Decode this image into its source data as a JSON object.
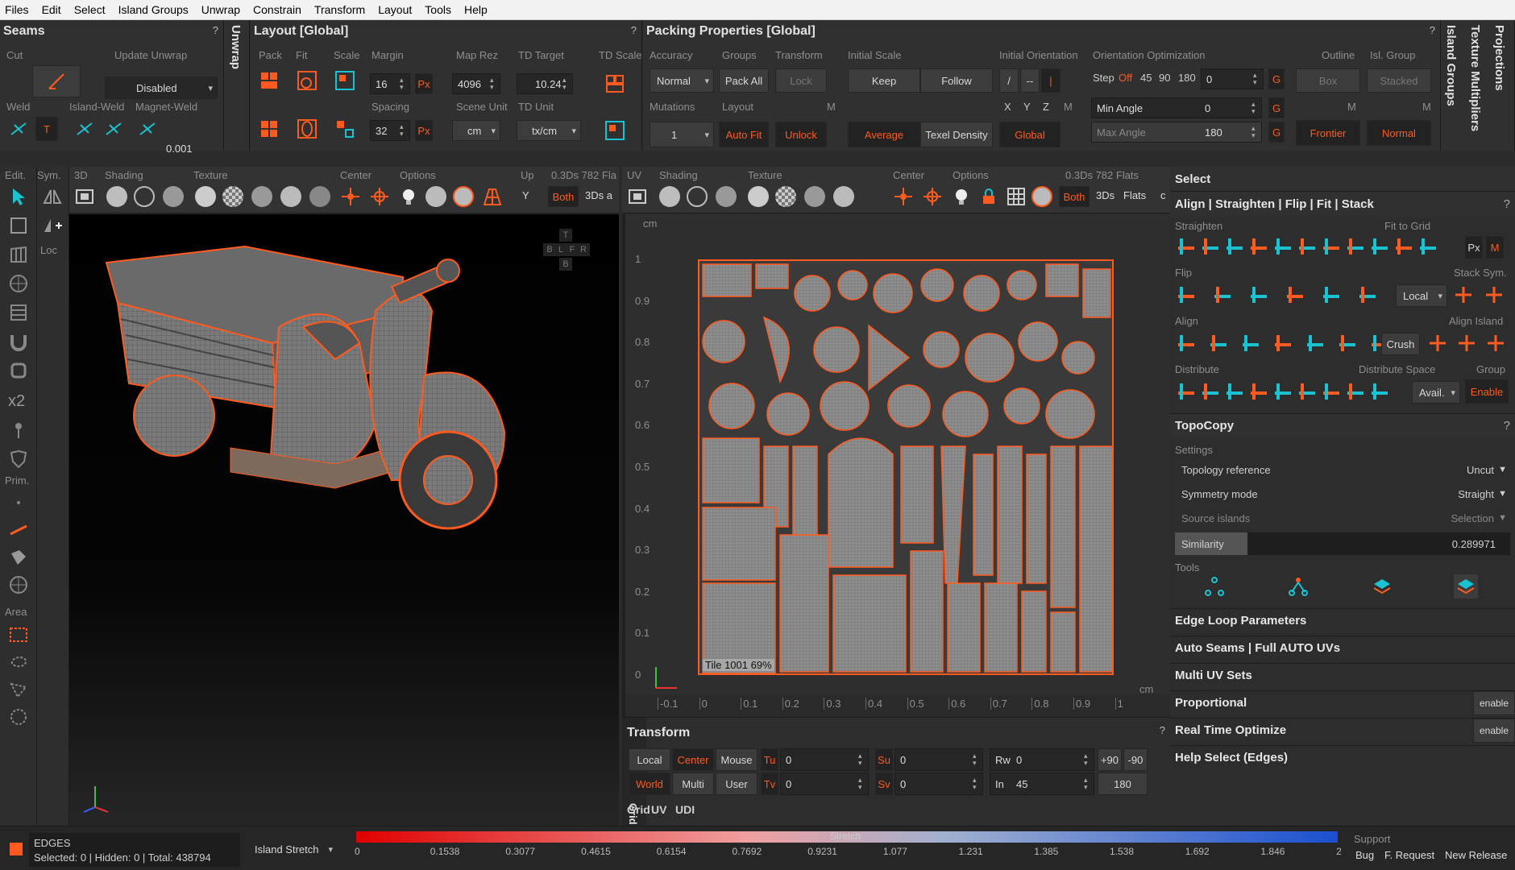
{
  "menu": [
    "Files",
    "Edit",
    "Select",
    "Island Groups",
    "Unwrap",
    "Constrain",
    "Transform",
    "Layout",
    "Tools",
    "Help"
  ],
  "seams": {
    "title": "Seams",
    "q": "?",
    "cut": "Cut",
    "update_unwrap": "Update Unwrap",
    "disabled": "Disabled",
    "weld": "Weld",
    "island_weld": "Island-Weld",
    "magnet_weld": "Magnet-Weld",
    "t": "T",
    "magnet_value": "0.001"
  },
  "unwrap_vertical": "Unwrap",
  "layout": {
    "title": "Layout [Global]",
    "q": "?",
    "pack": "Pack",
    "fit": "Fit",
    "scale": "Scale",
    "margin": "Margin",
    "margin_val": "16",
    "px": "Px",
    "spacing": "Spacing",
    "spacing_val": "32",
    "map_rez": "Map Rez",
    "map_rez_val": "4096",
    "scene_unit": "Scene Unit",
    "scene_unit_val": "cm",
    "td_target": "TD Target",
    "td_val": "10.24",
    "td_unit": "TD Unit",
    "td_unit_val": "tx/cm",
    "td_scale": "TD Scale"
  },
  "packing": {
    "title": "Packing Properties [Global]",
    "q": "?",
    "accuracy": "Accuracy",
    "accuracy_val": "Normal",
    "groups": "Groups",
    "pack_all": "Pack All",
    "transform": "Transform",
    "lock": "Lock",
    "initial_scale": "Initial Scale",
    "keep": "Keep",
    "follow": "Follow",
    "mutations": "Mutations",
    "mutations_val": "1",
    "layout_lbl": "Layout",
    "auto_fit": "Auto Fit",
    "unlock": "Unlock",
    "m": "M",
    "average": "Average",
    "texel_density": "Texel Density",
    "initial_orientation": "Initial Orientation",
    "slash": "/",
    "dash": "--",
    "bar": "|",
    "x": "X",
    "y": "Y",
    "z": "Z",
    "global": "Global",
    "orientation_opt": "Orientation Optimization",
    "step": "Step",
    "off": "Off",
    "a45": "45",
    "a90": "90",
    "a180": "180",
    "step_val": "0",
    "g": "G",
    "min_angle": "Min Angle",
    "min_angle_val": "0",
    "max_angle": "Max Angle",
    "max_angle_val": "180",
    "outline": "Outline",
    "box": "Box",
    "frontier": "Frontier",
    "isl_group": "Isl. Group",
    "stacked": "Stacked",
    "normal": "Normal"
  },
  "vertical_tabs": [
    "Island Groups",
    "Texture Multipliers",
    "Projections"
  ],
  "vp3d": {
    "edit": "Edit.",
    "sym": "Sym.",
    "d3": "3D",
    "shading": "Shading",
    "texture": "Texture",
    "center": "Center",
    "options": "Options",
    "up": "Up",
    "info": "0.3Ds 782 Fla",
    "y": "Y",
    "both": "Both",
    "ds": "3Ds a",
    "loc": "Loc",
    "x2": "x2",
    "prim": "Prim.",
    "area": "Area",
    "t": "T",
    "b": "B",
    "l": "L",
    "f": "F",
    "r": "R",
    "bb": "B"
  },
  "vpuv": {
    "uv": "UV",
    "shading": "Shading",
    "texture": "Texture",
    "center": "Center",
    "options": "Options",
    "info": "0.3Ds 782 Flats",
    "both": "Both",
    "ds": "3Ds",
    "flats": "Flats",
    "c": "c",
    "cm": "cm",
    "tile": "Tile 1001 69%",
    "yticks": [
      "1",
      "0.9",
      "0.8",
      "0.7",
      "0.6",
      "0.5",
      "0.4",
      "0.3",
      "0.2",
      "0.1",
      "0"
    ],
    "xticks": [
      "-0.1",
      "0",
      "0.1",
      "0.2",
      "0.3",
      "0.4",
      "0.5",
      "0.6",
      "0.7",
      "0.8",
      "0.9",
      "1"
    ],
    "xcm": "cm"
  },
  "transform": {
    "title": "Transform",
    "q": "?",
    "local": "Local",
    "center": "Center",
    "mouse": "Mouse",
    "world": "World",
    "multi": "Multi",
    "user": "User",
    "tu": "Tu",
    "tv": "Tv",
    "su": "Su",
    "sv": "Sv",
    "rw": "Rw",
    "in": "In",
    "tu_val": "0",
    "tv_val": "0",
    "su_val": "0",
    "sv_val": "0",
    "rw_val": "0",
    "in_val": "45",
    "p90": "+90",
    "m90": "-90",
    "r180": "180"
  },
  "uv_bottom_tabs": [
    "Grid",
    "UV",
    "UDI"
  ],
  "right": {
    "select": "Select",
    "align_title": "Align | Straighten | Flip | Fit | Stack",
    "q": "?",
    "straighten": "Straighten",
    "fit_to_grid": "Fit to Grid",
    "px": "Px",
    "m": "M",
    "flip": "Flip",
    "stack_sym": "Stack Sym.",
    "local": "Local",
    "align": "Align",
    "align_island": "Align Island",
    "crush": "Crush",
    "distribute": "Distribute",
    "distribute_space": "Distribute Space",
    "group": "Group",
    "avail": "Avail.",
    "enable": "Enable",
    "topocopy": "TopoCopy",
    "settings": "Settings",
    "topology_ref": "Topology reference",
    "uncut": "Uncut",
    "symmetry_mode": "Symmetry mode",
    "straight": "Straight",
    "source_islands": "Source islands",
    "selection": "Selection",
    "similarity": "Similarity",
    "similarity_val": "0.289971",
    "tools": "Tools",
    "edge_loop": "Edge Loop Parameters",
    "auto_seams": "Auto Seams | Full AUTO UVs",
    "multi_uv": "Multi UV Sets",
    "proportional": "Proportional",
    "rt_optimize": "Real Time Optimize",
    "enable_small": "enable",
    "help_select": "Help Select (Edges)"
  },
  "status": {
    "mode": "EDGES",
    "selected": "Selected: 0 | Hidden: 0 | Total: 438794",
    "island_stretch": "Island Stretch",
    "stretch": "Stretch",
    "ticks": [
      "0",
      "0.1538",
      "0.3077",
      "0.4615",
      "0.6154",
      "0.7692",
      "0.9231",
      "1.077",
      "1.231",
      "1.385",
      "1.538",
      "1.692",
      "1.846",
      "2"
    ],
    "support": "Support",
    "bug": "Bug",
    "f_request": "F. Request",
    "new_release": "New Release"
  },
  "colors": {
    "accent": "#ff5a1f",
    "cyan": "#19c3d1",
    "bg": "#2b2b2b"
  }
}
